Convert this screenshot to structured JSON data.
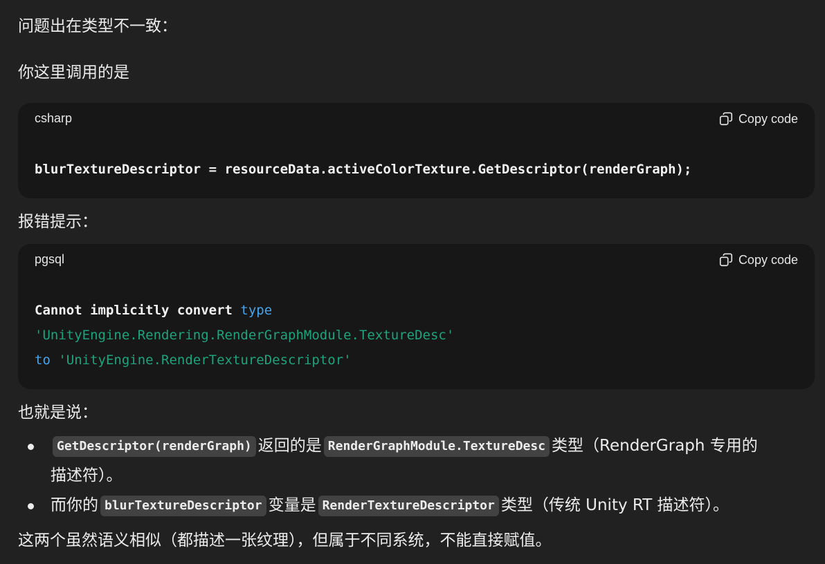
{
  "paragraphs": {
    "p1": "问题出在类型不一致：",
    "p2": "你这里调用的是",
    "p3": "报错提示：",
    "p4": "也就是说：",
    "p5": "这两个虽然语义相似（都描述一张纹理），但属于不同系统，不能直接赋值。"
  },
  "code_blocks": [
    {
      "language": "csharp",
      "copy_label": "Copy code",
      "line1": "blurTextureDescriptor = resourceData.activeColorTexture.GetDescriptor(renderGraph);"
    },
    {
      "language": "pgsql",
      "copy_label": "Copy code",
      "line1_text": "Cannot implicitly convert ",
      "line1_kw": "type",
      "line2_str": "'UnityEngine.Rendering.RenderGraphModule.TextureDesc'",
      "line3_kw": "to",
      "line3_str": " 'UnityEngine.RenderTextureDescriptor'"
    }
  ],
  "bullets": [
    {
      "code_a": "GetDescriptor(renderGraph)",
      "text_a": "返回的是",
      "code_b": "RenderGraphModule.TextureDesc",
      "text_b": "类型（RenderGraph 专用的",
      "text_c": "描述符）。"
    },
    {
      "text_pre": "而你的",
      "code_a": "blurTextureDescriptor",
      "text_a": "变量是",
      "code_b": "RenderTextureDescriptor",
      "text_b": "类型（传统 Unity RT 描述符）。"
    }
  ],
  "colors": {
    "background": "#212121",
    "code_background": "#171717",
    "keyword": "#4aa3e8",
    "string": "#1fa37c",
    "inline_code_bg": "#424242"
  },
  "icons": {
    "copy": "copy-icon"
  }
}
